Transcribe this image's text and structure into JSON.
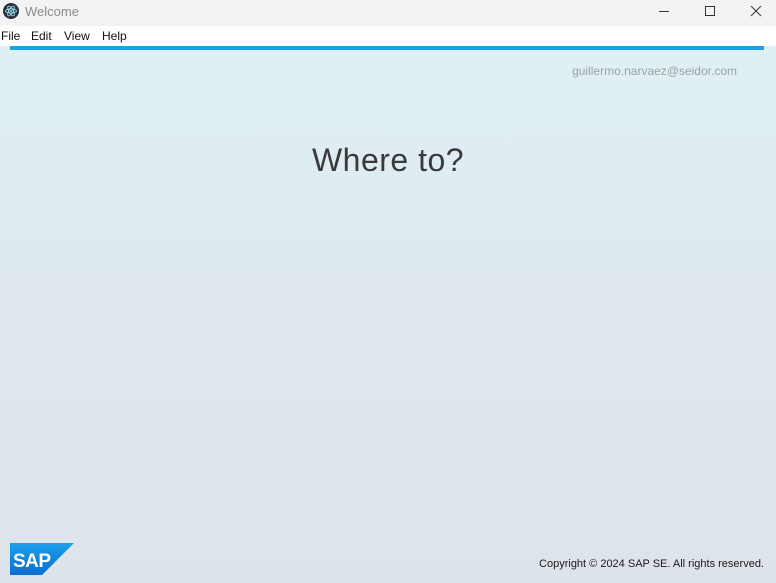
{
  "window": {
    "title": "Welcome",
    "app_icon": "electron-atom-icon",
    "controls": {
      "minimize_icon": "minimize-icon",
      "maximize_icon": "maximize-icon",
      "close_icon": "close-icon"
    }
  },
  "menubar": {
    "items": [
      {
        "label": "File"
      },
      {
        "label": "Edit"
      },
      {
        "label": "View"
      },
      {
        "label": "Help"
      }
    ]
  },
  "content": {
    "user_email": "guillermo.narvaez@seidor.com",
    "headline": "Where to?",
    "logo": {
      "text": "SAP",
      "color": "#0a6ed1"
    },
    "copyright": "Copyright © 2024 SAP SE. All rights reserved."
  },
  "colors": {
    "accent": "#1ea1e0",
    "brand": "#0a6ed1"
  }
}
